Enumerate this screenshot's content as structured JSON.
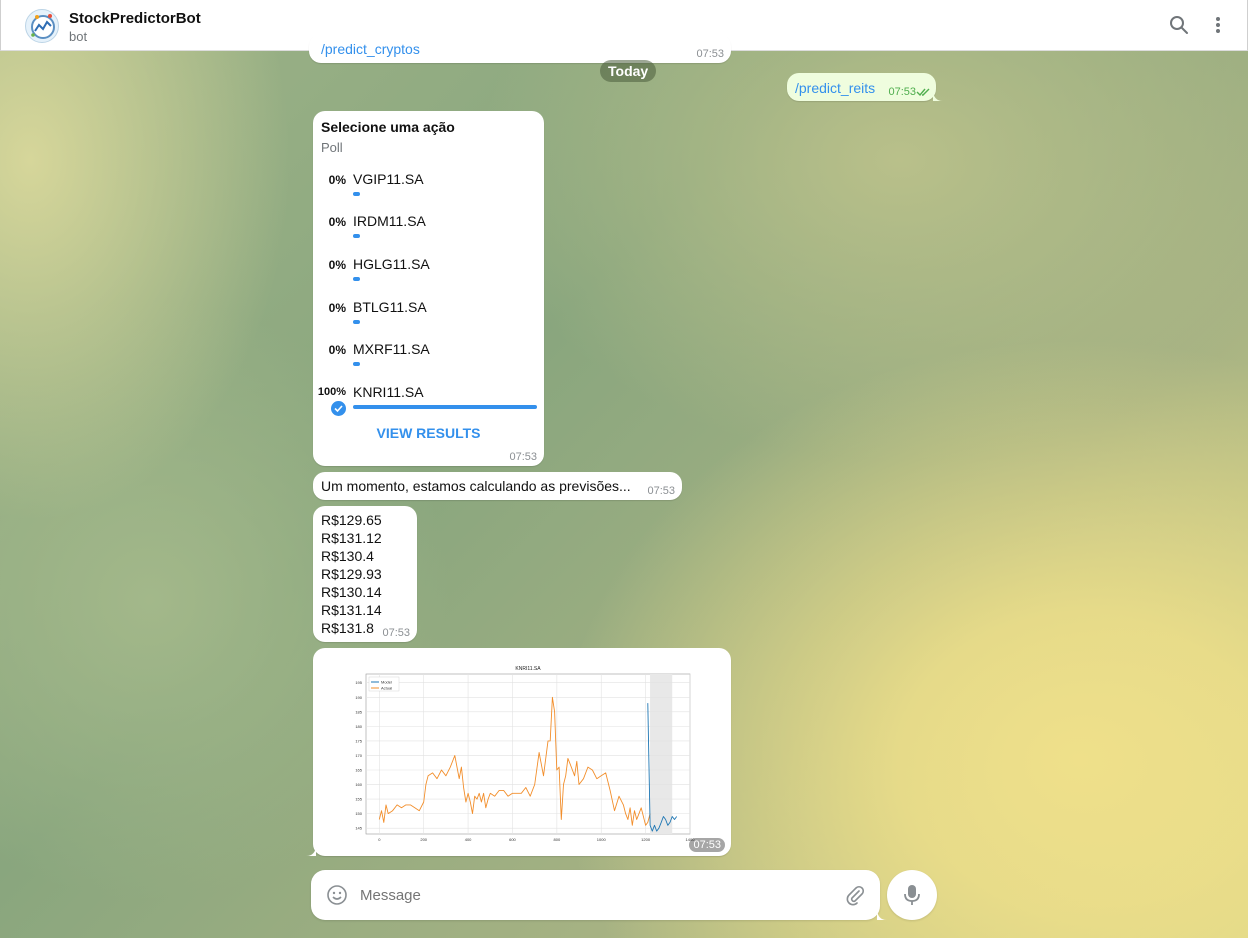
{
  "header": {
    "title": "StockPredictorBot",
    "status": "bot"
  },
  "date_divider": "Today",
  "messages": {
    "prev": {
      "text": "/predict_cryptos",
      "time": "07:53"
    },
    "outgoing": {
      "text": "/predict_reits",
      "time": "07:53"
    },
    "poll": {
      "question": "Selecione uma ação",
      "type": "Poll",
      "options": [
        {
          "percent": "0%",
          "label": "VGIP11.SA",
          "fill": 0
        },
        {
          "percent": "0%",
          "label": "IRDM11.SA",
          "fill": 0
        },
        {
          "percent": "0%",
          "label": "HGLG11.SA",
          "fill": 0
        },
        {
          "percent": "0%",
          "label": "BTLG11.SA",
          "fill": 0
        },
        {
          "percent": "0%",
          "label": "MXRF11.SA",
          "fill": 0
        },
        {
          "percent": "100%",
          "label": "KNRI11.SA",
          "fill": 1
        }
      ],
      "view_results": "VIEW RESULTS",
      "time": "07:53"
    },
    "calculating": {
      "text": "Um momento, estamos calculando as previsões...",
      "time": "07:53"
    },
    "prices": {
      "values": [
        "R$129.65",
        "R$131.12",
        "R$130.4",
        "R$129.93",
        "R$130.14",
        "R$131.14",
        "R$131.8"
      ],
      "time": "07:53"
    },
    "chart_message": {
      "time": "07:53"
    }
  },
  "composer": {
    "placeholder": "Message"
  },
  "colors": {
    "accent": "#3390ec",
    "actual_series": "#f28e2b",
    "model_series": "#1f77b4",
    "outgoing_bubble": "#effdde"
  },
  "icons": [
    "search-icon",
    "more-vert-icon",
    "emoji-icon",
    "attach-icon",
    "mic-icon",
    "double-check-icon",
    "check-icon"
  ],
  "chart_data": {
    "type": "line",
    "title": "KNRI11.SA",
    "legend": [
      "Model",
      "Actual"
    ],
    "legend_position": "top-left",
    "grid": true,
    "xlim": [
      -60,
      1400
    ],
    "ylim": [
      143,
      198
    ],
    "xticks": [
      "0",
      "200",
      "400",
      "600",
      "800",
      "1000",
      "1200",
      "1400"
    ],
    "yticks": [
      "145",
      "150",
      "155",
      "160",
      "165",
      "170",
      "175",
      "180",
      "185",
      "190",
      "195"
    ],
    "series": [
      {
        "name": "Actual",
        "x": [
          0,
          10,
          20,
          30,
          40,
          60,
          80,
          100,
          120,
          140,
          160,
          180,
          200,
          210,
          220,
          240,
          260,
          280,
          300,
          320,
          340,
          360,
          370,
          380,
          390,
          400,
          410,
          420,
          430,
          440,
          450,
          460,
          470,
          480,
          490,
          500,
          520,
          540,
          560,
          580,
          600,
          620,
          640,
          660,
          680,
          700,
          720,
          740,
          760,
          770,
          780,
          790,
          800,
          810,
          820,
          830,
          840,
          850,
          860,
          870,
          880,
          890,
          900,
          920,
          940,
          960,
          980,
          1000,
          1020,
          1040,
          1060,
          1080,
          1100,
          1110,
          1120,
          1130,
          1140,
          1150,
          1160,
          1170,
          1180,
          1190,
          1200,
          1210,
          1220
        ],
        "y": [
          148,
          151,
          147,
          153,
          150,
          151,
          153,
          152,
          153,
          153,
          152,
          151,
          154,
          160,
          163,
          164,
          162,
          165,
          163,
          166,
          170,
          162,
          166,
          159,
          154,
          157,
          154,
          150,
          156,
          155,
          157,
          154,
          157,
          152,
          155,
          157,
          156,
          158,
          158,
          156,
          157,
          157,
          157,
          159,
          156,
          160,
          171,
          163,
          175,
          175,
          190,
          185,
          165,
          166,
          148,
          160,
          163,
          169,
          167,
          165,
          163,
          168,
          160,
          162,
          166,
          165,
          162,
          163,
          164,
          158,
          151,
          156,
          153,
          150,
          148,
          152,
          146,
          151,
          148,
          150,
          152,
          149,
          146,
          147,
          150
        ]
      },
      {
        "name": "Model",
        "x": [
          1210,
          1220,
          1230,
          1240,
          1250,
          1260,
          1270,
          1280,
          1290,
          1300,
          1310,
          1320,
          1330,
          1340
        ],
        "y": [
          188,
          146,
          144,
          146,
          144,
          145,
          147,
          149,
          148,
          146,
          147,
          149,
          148,
          149
        ]
      }
    ],
    "forecast_shading": [
      1220,
      1320
    ]
  }
}
